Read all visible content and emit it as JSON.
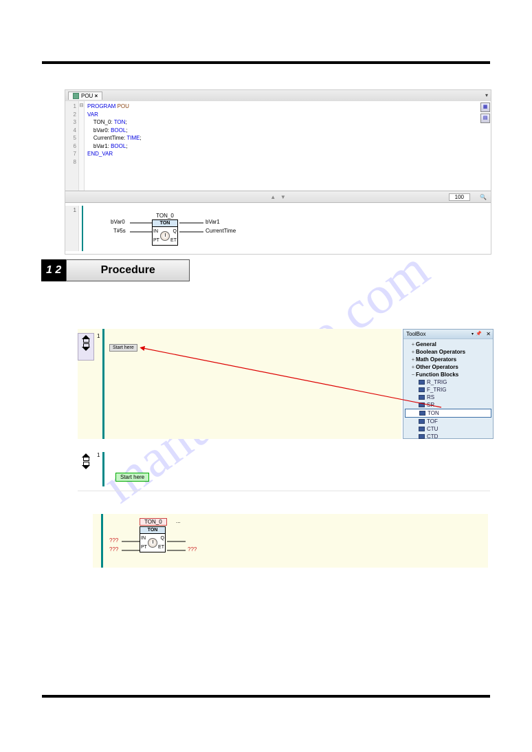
{
  "watermark": "manualshive.com",
  "editor": {
    "tab": "POU",
    "close": "×",
    "line_numbers": [
      "1",
      "2",
      "3",
      "4",
      "5",
      "6",
      "7",
      "8"
    ],
    "fold_marks": [
      "",
      "⊟",
      "",
      "",
      "",
      "",
      "",
      ""
    ],
    "code": {
      "l1a": "PROGRAM",
      "l1b": " POU",
      "l2": "VAR",
      "l3a": "    TON_0: ",
      "l3b": "TON",
      "l3c": ";",
      "l4a": "    bVar0: ",
      "l4b": "BOOL",
      "l4c": ";",
      "l5a": "    CurrentTime: ",
      "l5b": "TIME",
      "l5c": ";",
      "l6a": "    bVar1: ",
      "l6b": "BOOL",
      "l6c": ";",
      "l7": "END_VAR",
      "l8": ""
    },
    "status_value": "100"
  },
  "fbd": {
    "net_number": "1",
    "block_instance": "TON_0",
    "block_type": "TON",
    "ports": {
      "in": "IN",
      "pt": "PT",
      "q": "Q",
      "et": "ET"
    },
    "inputs": {
      "in": "bVar0",
      "pt": "T#5s"
    },
    "outputs": {
      "q": "bVar1",
      "et": "CurrentTime"
    }
  },
  "procedure": {
    "number": "1 2",
    "label": "Procedure"
  },
  "drag": {
    "net_number": "1",
    "start_here": "Start here"
  },
  "toolbox": {
    "title": "ToolBox",
    "groups": [
      {
        "exp": "+",
        "label": "General"
      },
      {
        "exp": "+",
        "label": "Boolean Operators"
      },
      {
        "exp": "+",
        "label": "Math Operators"
      },
      {
        "exp": "+",
        "label": "Other Operators"
      },
      {
        "exp": "−",
        "label": "Function Blocks"
      }
    ],
    "items": [
      {
        "label": "R_TRIG",
        "selected": false
      },
      {
        "label": "F_TRIG",
        "selected": false
      },
      {
        "label": "RS",
        "selected": false
      },
      {
        "label": "SR",
        "selected": false
      },
      {
        "label": "TON",
        "selected": true
      },
      {
        "label": "TOF",
        "selected": false
      },
      {
        "label": "CTU",
        "selected": false
      },
      {
        "label": "CTD",
        "selected": false
      }
    ]
  },
  "section2": {
    "net_number": "1",
    "start_here": "Start here"
  },
  "section3": {
    "block_name": "TON_0",
    "block_type": "TON",
    "dots": "...",
    "in_val": "???",
    "pt_val": "???",
    "q_val": "",
    "et_val": "???",
    "ports": {
      "in": "IN",
      "pt": "PT",
      "q": "Q",
      "et": "ET"
    }
  }
}
